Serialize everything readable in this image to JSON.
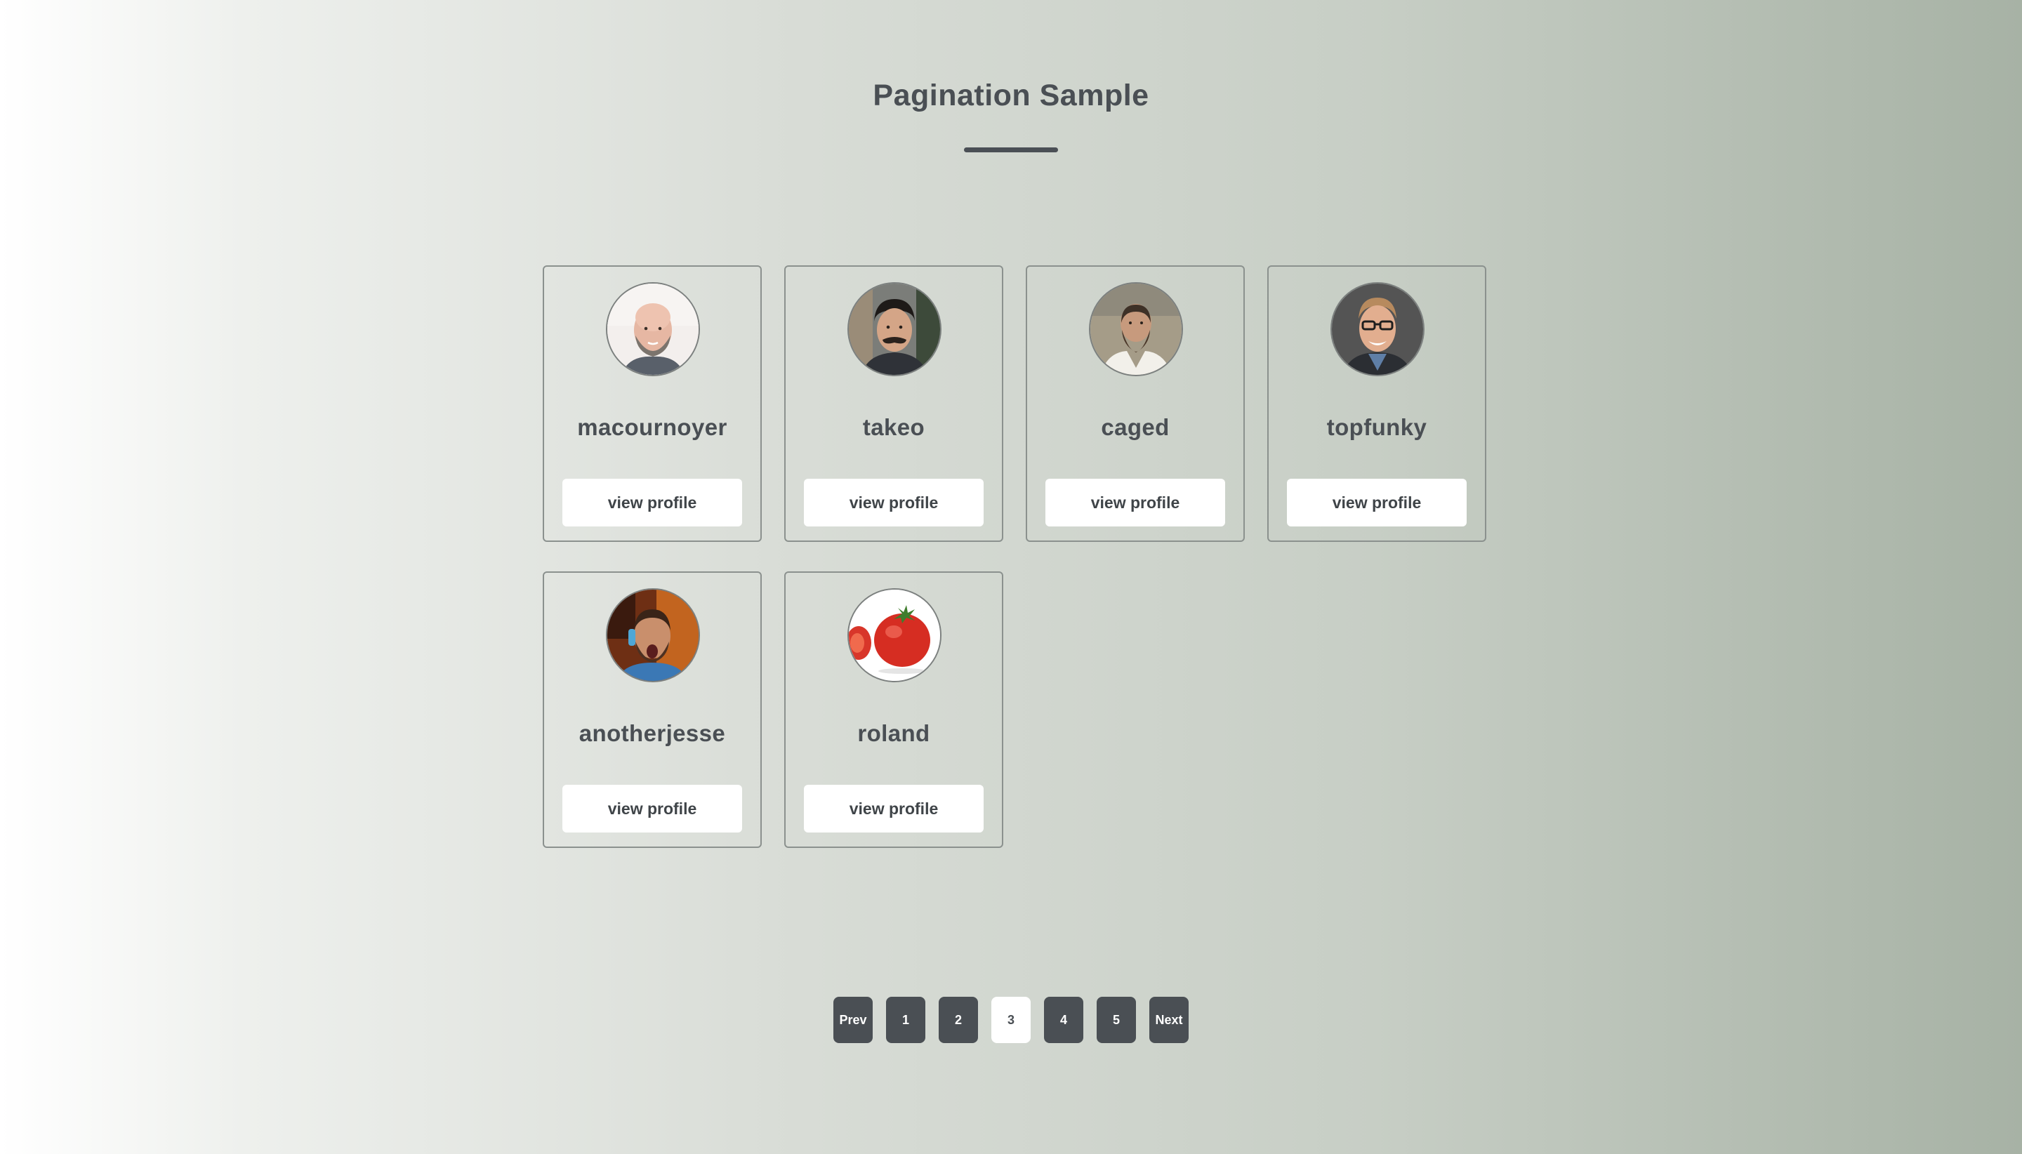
{
  "page": {
    "title": "Pagination Sample"
  },
  "profiles": [
    {
      "username": "macournoyer",
      "button_label": "view profile",
      "avatar_icon": "bald-bearded-man-avatar-icon"
    },
    {
      "username": "takeo",
      "button_label": "view profile",
      "avatar_icon": "mustached-man-avatar-icon"
    },
    {
      "username": "caged",
      "button_label": "view profile",
      "avatar_icon": "long-beard-man-avatar-icon"
    },
    {
      "username": "topfunky",
      "button_label": "view profile",
      "avatar_icon": "glasses-man-avatar-icon"
    },
    {
      "username": "anotherjesse",
      "button_label": "view profile",
      "avatar_icon": "headphones-man-avatar-icon"
    },
    {
      "username": "roland",
      "button_label": "view profile",
      "avatar_icon": "tomato-avatar-icon"
    }
  ],
  "pagination": {
    "prev_label": "Prev",
    "next_label": "Next",
    "pages": [
      "1",
      "2",
      "3",
      "4",
      "5"
    ],
    "current_page": "3"
  },
  "colors": {
    "text": "#4a4f54",
    "button_bg": "#ffffff",
    "page_button_bg": "#4a4f54",
    "card_border": "#8b918e"
  }
}
